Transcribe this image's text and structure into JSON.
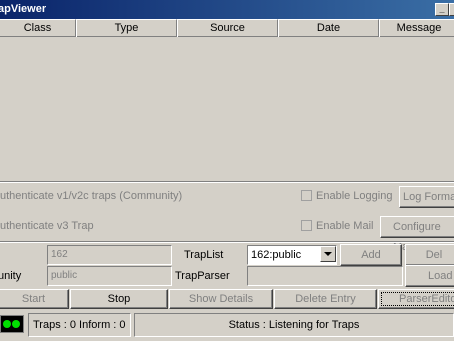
{
  "window": {
    "title": "apViewer",
    "minimize_glyph": "_",
    "maximize_glyph": "□"
  },
  "table": {
    "columns": [
      "Class",
      "Type",
      "Source",
      "Date",
      "Message"
    ]
  },
  "options": {
    "auth_v1v2c": "uthenticate v1/v2c traps (Community)",
    "auth_v3": "uthenticate v3 Trap",
    "enable_logging": "Enable Logging",
    "enable_mail": "Enable Mail",
    "log_format_button": "Log Forma",
    "configure_mail_button": "Configure Ma"
  },
  "settings": {
    "port_value": "162",
    "community_label": "unity",
    "community_value": "public",
    "traplist_label": "TrapList",
    "traplist_selected": "162:public",
    "trapparser_label": "TrapParser",
    "trapparser_value": "",
    "add_button": "Add",
    "del_button": "Del",
    "load_button": "Load"
  },
  "actions": {
    "start": "Start",
    "stop": "Stop",
    "show_details": "Show Details",
    "delete_entry": "Delete Entry",
    "parser_editor": "ParserEditor"
  },
  "status": {
    "counts": "Traps :  0 Inform :  0",
    "message": "Status : Listening for Traps",
    "led_color": "#00e000"
  }
}
